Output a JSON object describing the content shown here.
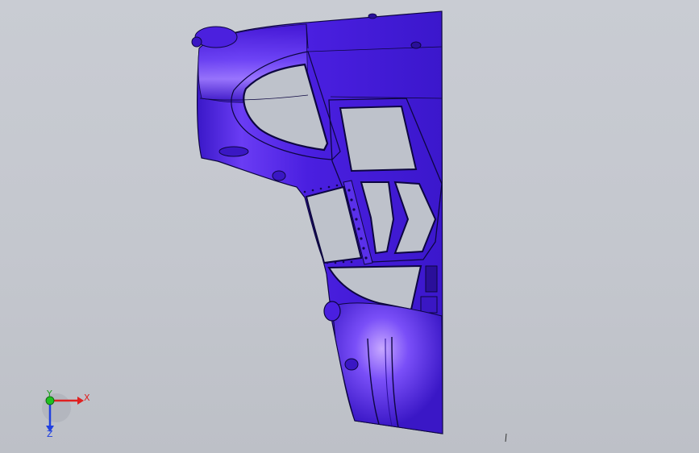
{
  "viewport": {
    "background_top": "#c9ccd3",
    "background_bottom": "#bdc0c7"
  },
  "model": {
    "body_color": "#4a1fe0",
    "body_dark": "#23108c",
    "highlight_color": "#b59cff",
    "edge_color": "#0d0640"
  },
  "triad": {
    "x_label": "X",
    "y_label": "Y",
    "z_label": "Z",
    "x_color": "#e02020",
    "y_color": "#20c020",
    "z_color": "#2040e0"
  },
  "cursor_icon": "text-cursor-icon"
}
